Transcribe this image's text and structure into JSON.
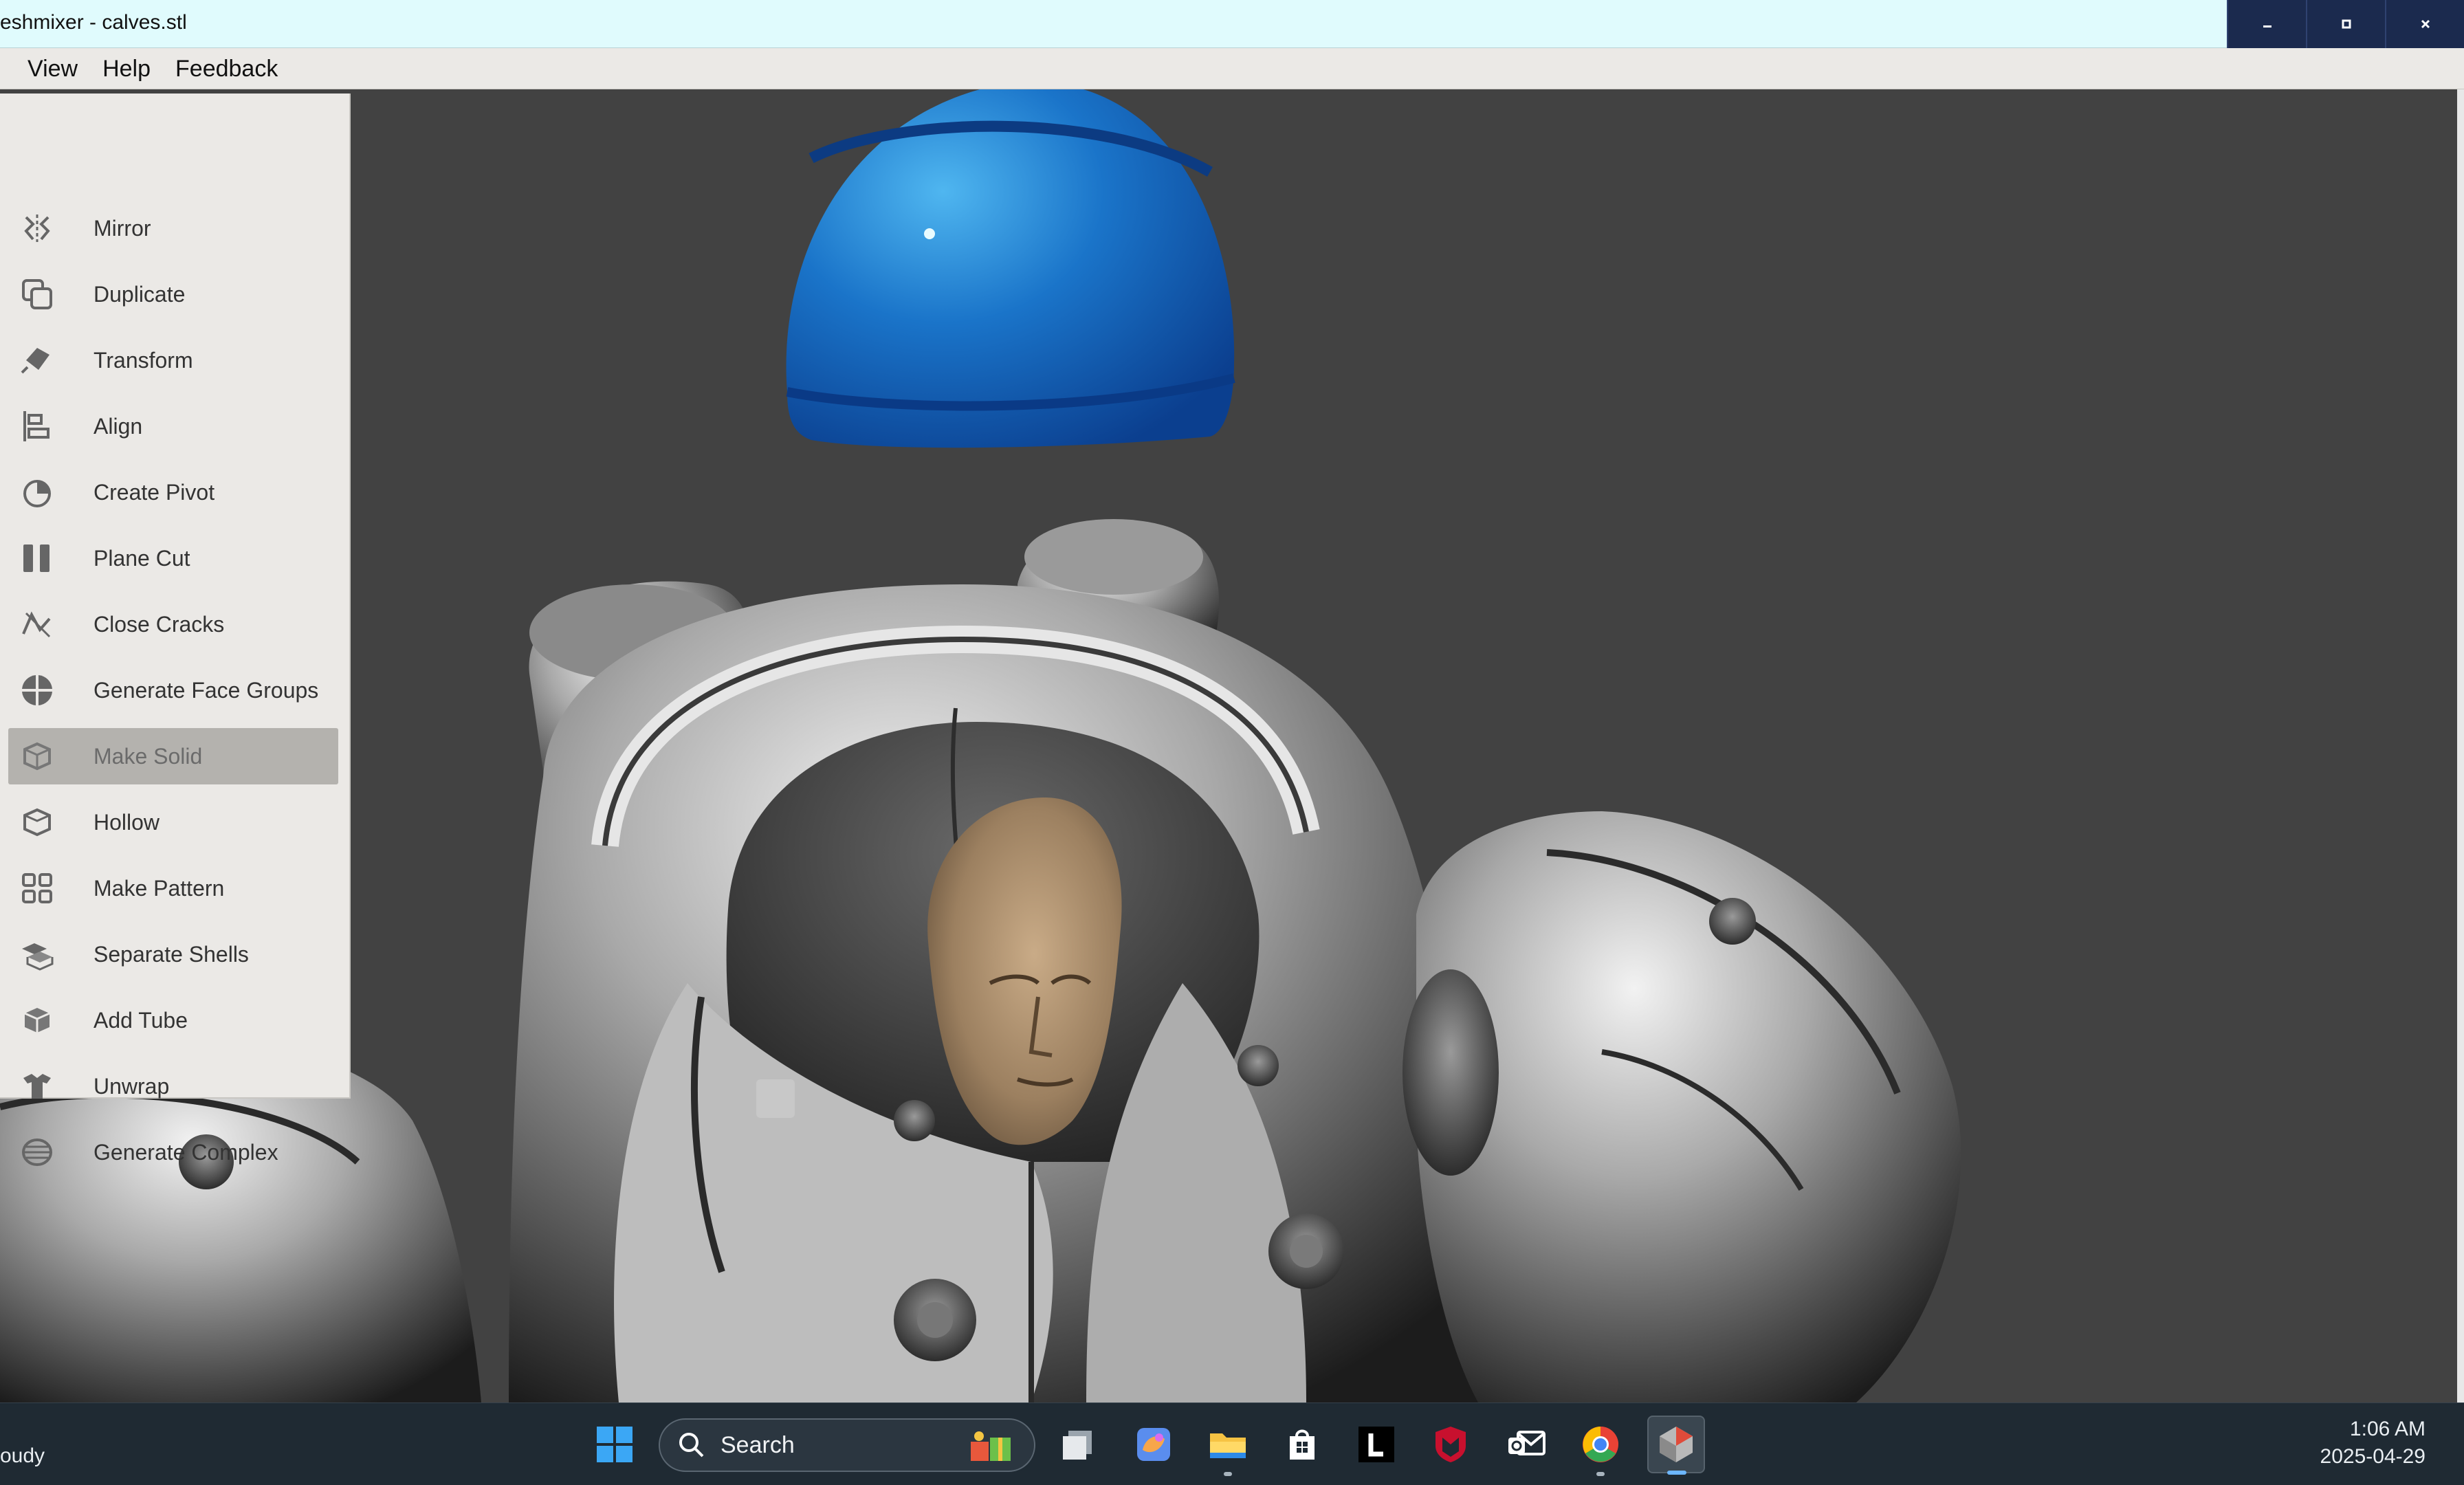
{
  "window": {
    "title": "eshmixer - calves.stl",
    "controls": {
      "minimize": "minimize-icon",
      "maximize": "maximize-icon",
      "close": "close-icon"
    }
  },
  "menubar": {
    "items": [
      "View",
      "Help",
      "Feedback"
    ]
  },
  "edit_menu": {
    "items": [
      {
        "label": "Mirror",
        "icon": "mirror-icon"
      },
      {
        "label": "Duplicate",
        "icon": "duplicate-icon"
      },
      {
        "label": "Transform",
        "icon": "transform-icon"
      },
      {
        "label": "Align",
        "icon": "align-icon"
      },
      {
        "label": "Create Pivot",
        "icon": "pivot-icon"
      },
      {
        "label": "Plane Cut",
        "icon": "plane-cut-icon"
      },
      {
        "label": "Close Cracks",
        "icon": "close-cracks-icon"
      },
      {
        "label": "Generate Face Groups",
        "icon": "face-groups-icon"
      },
      {
        "label": "Make Solid",
        "icon": "make-solid-icon",
        "highlighted": true
      },
      {
        "label": "Hollow",
        "icon": "hollow-icon"
      },
      {
        "label": "Make Pattern",
        "icon": "pattern-icon"
      },
      {
        "label": "Separate Shells",
        "icon": "separate-shells-icon"
      },
      {
        "label": "Add Tube",
        "icon": "add-tube-icon"
      },
      {
        "label": "Unwrap",
        "icon": "unwrap-icon"
      },
      {
        "label": "Generate Complex",
        "icon": "generate-complex-icon"
      }
    ]
  },
  "viewport": {
    "background": "#424242",
    "objects": [
      "blue-helmet",
      "armored-suit",
      "tan-head"
    ]
  },
  "taskbar": {
    "weather_text": "oudy",
    "search_label": "Search",
    "apps": [
      "windows-start-icon",
      "task-view-icon",
      "copilot-icon",
      "file-explorer-icon",
      "microsoft-store-icon",
      "l-app-icon",
      "mcafee-icon",
      "outlook-icon",
      "chrome-icon",
      "meshmixer-icon"
    ],
    "time": "1:06 AM",
    "date": "2025-04-29"
  }
}
